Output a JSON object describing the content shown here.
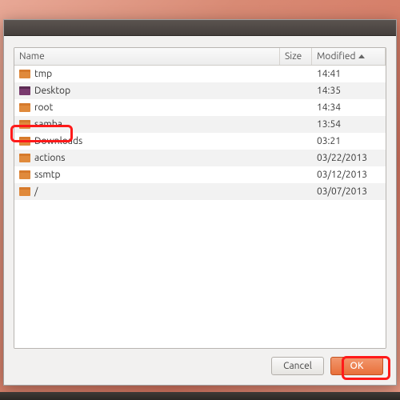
{
  "columns": {
    "name": "Name",
    "size": "Size",
    "modified": "Modified"
  },
  "sort_column": "Modified",
  "sort_direction": "ascending",
  "rows": [
    {
      "icon": "folder",
      "name": "tmp",
      "size": "",
      "modified": "14:41"
    },
    {
      "icon": "desktop",
      "name": "Desktop",
      "size": "",
      "modified": "14:35"
    },
    {
      "icon": "folder",
      "name": "root",
      "size": "",
      "modified": "14:34"
    },
    {
      "icon": "folder",
      "name": "samba",
      "size": "",
      "modified": "13:54"
    },
    {
      "icon": "folder",
      "name": "Downloads",
      "size": "",
      "modified": "03:21"
    },
    {
      "icon": "folder",
      "name": "actions",
      "size": "",
      "modified": "03/22/2013"
    },
    {
      "icon": "folder",
      "name": "ssmtp",
      "size": "",
      "modified": "03/12/2013"
    },
    {
      "icon": "folder",
      "name": "/",
      "size": "",
      "modified": "03/07/2013"
    }
  ],
  "buttons": {
    "cancel": "Cancel",
    "ok": "OK"
  },
  "annotations": {
    "highlight_row": "Downloads",
    "highlight_button": "ok"
  }
}
